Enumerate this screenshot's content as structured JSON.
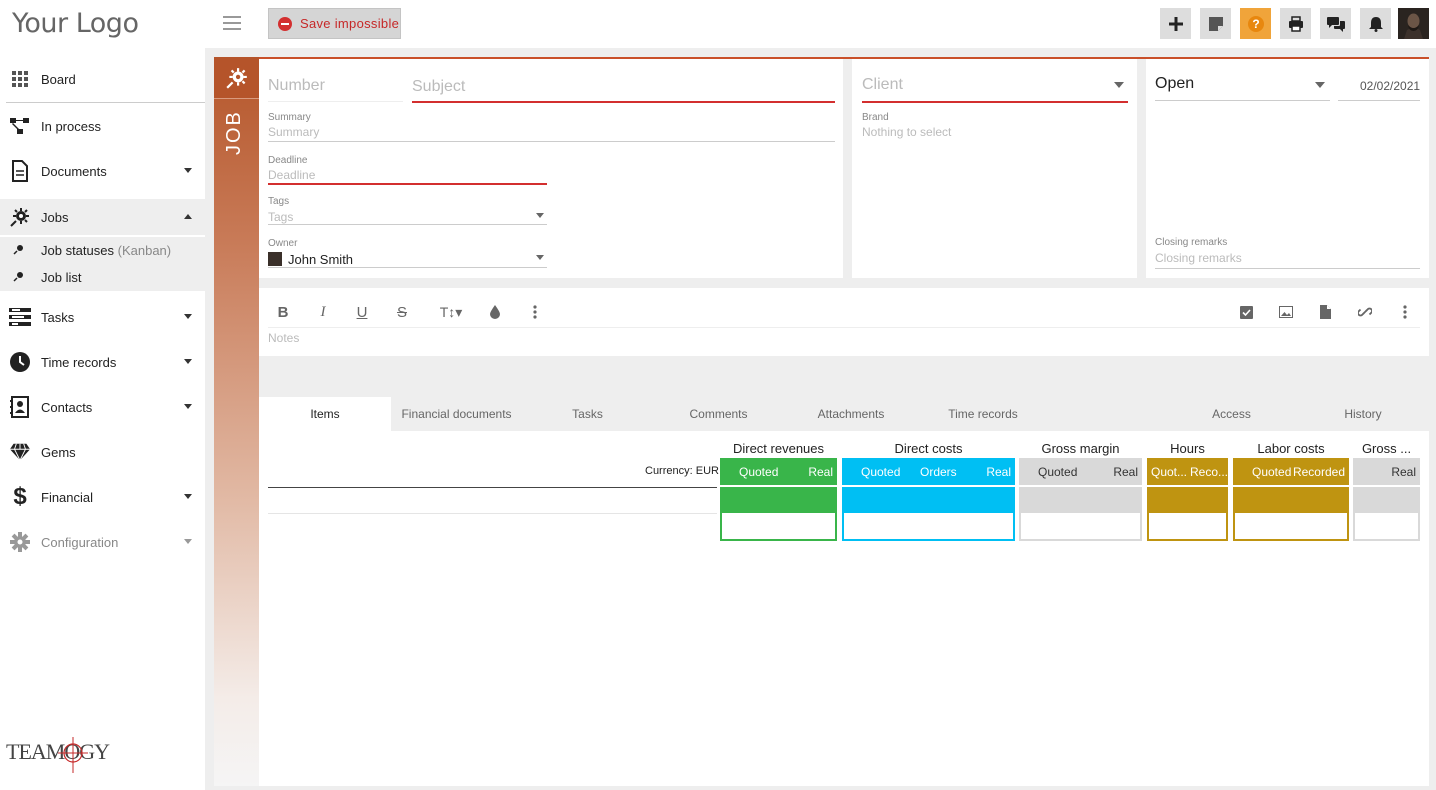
{
  "sidebar": {
    "logo": "Your Logo",
    "items": [
      {
        "label": "Board"
      },
      {
        "label": "In process"
      },
      {
        "label": "Documents"
      },
      {
        "label": "Jobs"
      },
      {
        "label": "Tasks"
      },
      {
        "label": "Time records"
      },
      {
        "label": "Contacts"
      },
      {
        "label": "Gems"
      },
      {
        "label": "Financial"
      },
      {
        "label": "Configuration"
      }
    ],
    "subitems": [
      {
        "label": "Job statuses",
        "suffix": "(Kanban)"
      },
      {
        "label": "Job list"
      }
    ],
    "footer_logo": "TEAMOGY"
  },
  "topbar": {
    "save_label": "Save impossible",
    "icons": [
      "plus-icon",
      "note-icon",
      "help-icon",
      "print-icon",
      "chat-icon",
      "bell-icon"
    ]
  },
  "job": {
    "strip_label": "JOB",
    "number_placeholder": "Number",
    "subject_placeholder": "Subject",
    "summary_label": "Summary",
    "summary_placeholder": "Summary",
    "deadline_label": "Deadline",
    "deadline_placeholder": "Deadline",
    "tags_label": "Tags",
    "tags_placeholder": "Tags",
    "owner_label": "Owner",
    "owner_value": "John Smith",
    "client_placeholder": "Client",
    "brand_label": "Brand",
    "brand_placeholder": "Nothing to select",
    "status_value": "Open",
    "date_value": "02/02/2021",
    "closing_label": "Closing remarks",
    "closing_placeholder": "Closing remarks",
    "notes_placeholder": "Notes"
  },
  "tabs": [
    {
      "label": "Items",
      "active": true
    },
    {
      "label": "Financial documents"
    },
    {
      "label": "Tasks"
    },
    {
      "label": "Comments"
    },
    {
      "label": "Attachments"
    },
    {
      "label": "Time records"
    },
    {
      "label": "Access"
    },
    {
      "label": "History"
    }
  ],
  "items_table": {
    "currency_label": "Currency: EUR",
    "groups": [
      {
        "title": "Direct revenues",
        "color": "#39b54a",
        "subs": [
          "Quoted",
          "Real"
        ]
      },
      {
        "title": "Direct costs",
        "color": "#00bff3",
        "subs": [
          "Quoted",
          "Orders",
          "Real"
        ]
      },
      {
        "title": "Gross margin",
        "color": "#d9d9d9",
        "subs": [
          "Quoted",
          "Real"
        ]
      },
      {
        "title": "Hours",
        "color": "#bf9411",
        "subs": [
          "Quot...",
          "Reco..."
        ]
      },
      {
        "title": "Labor costs",
        "color": "#bf9411",
        "subs": [
          "Quoted",
          "Recorded"
        ]
      },
      {
        "title": "Gross ...",
        "color": "#d9d9d9",
        "subs": [
          "Real"
        ]
      }
    ]
  }
}
